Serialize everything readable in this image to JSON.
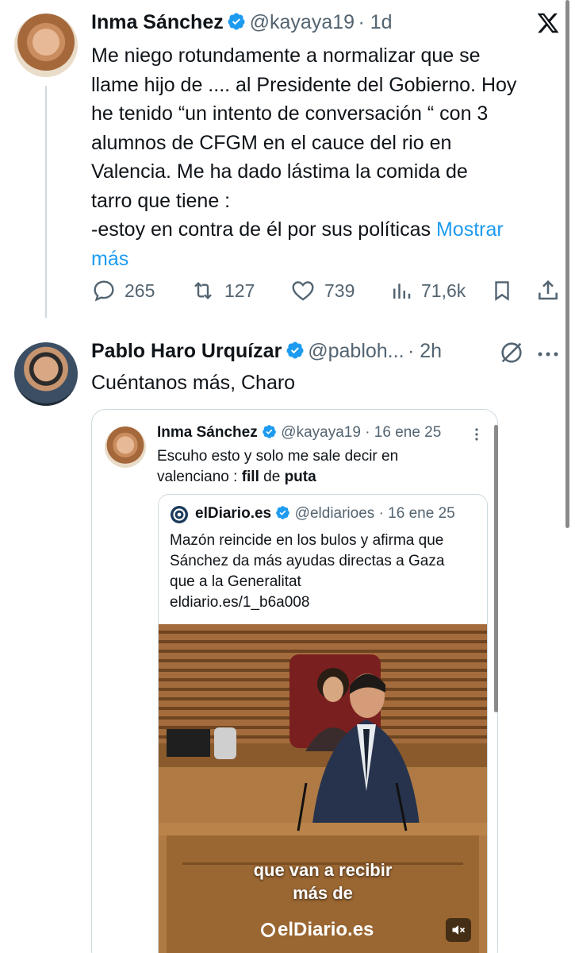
{
  "tweet1": {
    "name": "Inma Sánchez",
    "handle": "@kayaya19",
    "time": "· 1d",
    "lines": [
      "Me niego rotundamente a normalizar que se",
      "llame hijo de .... al Presidente del Gobierno. Hoy",
      "he tenido “un intento de conversación “ con 3",
      "alumnos de CFGM en el cauce del rio en",
      "Valencia. Me ha dado lástima la comida de",
      "tarro que tiene :"
    ],
    "last_line": "-estoy en contra de él por sus políticas",
    "show_more_1": "Mostrar",
    "show_more_2": "más",
    "replies": "265",
    "reposts": "127",
    "likes": "739",
    "views": "71,6k"
  },
  "tweet2": {
    "name": "Pablo Haro Urquízar",
    "handle": "@pabloh...",
    "time": "· 2h",
    "text": "Cuéntanos más, Charo"
  },
  "quote": {
    "name": "Inma Sánchez",
    "handle": "@kayaya19",
    "time": "· 16 ene 25",
    "line1": "Escuho esto y solo me sale decir en",
    "line2_pre": "valenciano : ",
    "line2_bold1": "fill",
    "line2_mid": " de ",
    "line2_bold2": "puta"
  },
  "inner_quote": {
    "name": "elDiario.es",
    "handle": "@eldiarioes",
    "time": "· 16 ene 25",
    "lines": [
      "Mazón reincide en los bulos y afirma que",
      "Sánchez da más ayudas directas a Gaza",
      "que a la Generalitat",
      "eldiario.es/1_b6a008"
    ],
    "video_caption_1": "que van a recibir",
    "video_caption_2": "más de",
    "video_watermark": "elDiario.es"
  },
  "icons": {
    "x_logo": "x-logo-icon",
    "verified_color": "#1d9bf0"
  }
}
